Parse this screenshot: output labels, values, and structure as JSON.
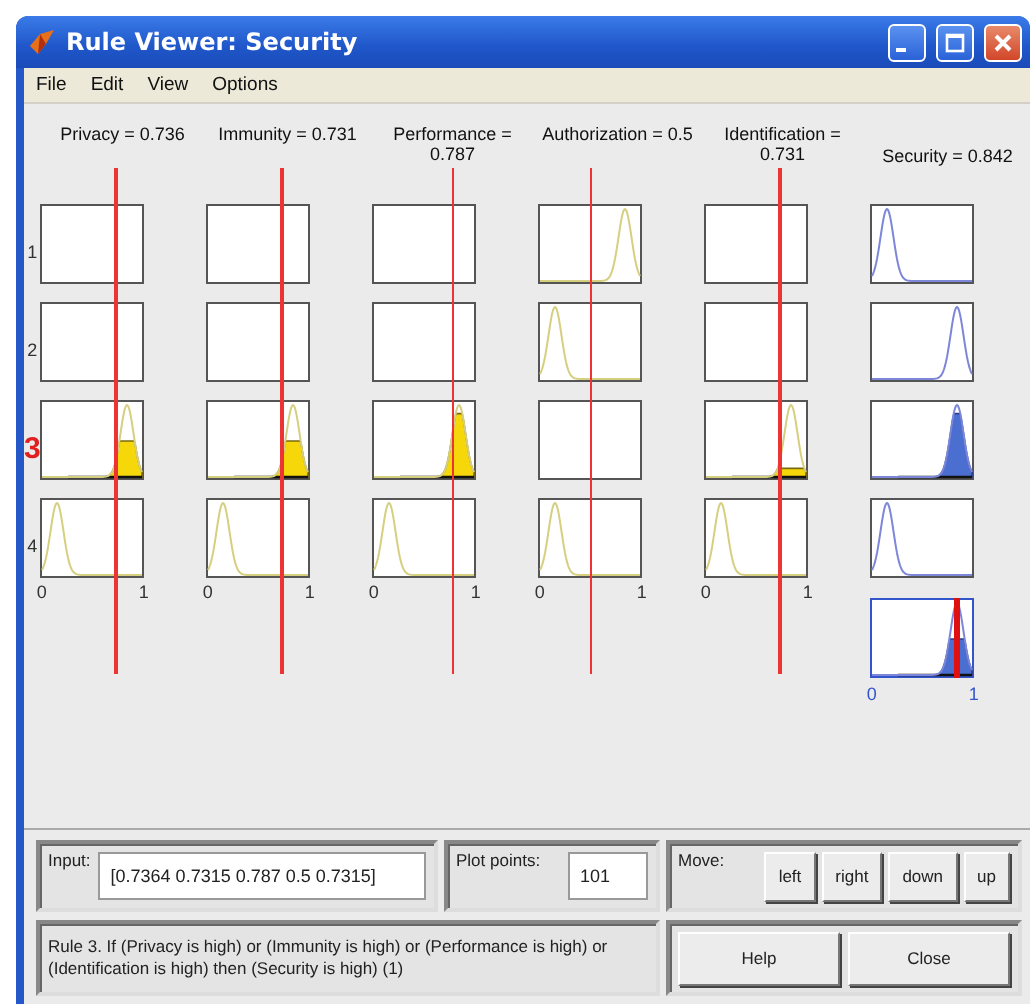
{
  "window": {
    "title": "Rule Viewer: Security"
  },
  "menu": [
    "File",
    "Edit",
    "View",
    "Options"
  ],
  "rules": [
    {
      "label": "1",
      "selected": false
    },
    {
      "label": "2",
      "selected": false
    },
    {
      "label": "3",
      "selected": true
    },
    {
      "label": "4",
      "selected": false
    }
  ],
  "inputs": [
    {
      "label": "Privacy = 0.736",
      "axis": [
        "0",
        "1"
      ],
      "cells": [
        {
          "kind": "blank"
        },
        {
          "kind": "blank"
        },
        {
          "kind": "halffired"
        },
        {
          "kind": "low"
        }
      ]
    },
    {
      "label": "Immunity = 0.731",
      "axis": [
        "0",
        "1"
      ],
      "cells": [
        {
          "kind": "blank"
        },
        {
          "kind": "blank"
        },
        {
          "kind": "halffired"
        },
        {
          "kind": "low"
        }
      ]
    },
    {
      "label": "Performance = 0.787",
      "axis": [
        "0",
        "1"
      ],
      "cells": [
        {
          "kind": "blank"
        },
        {
          "kind": "blank"
        },
        {
          "kind": "fullfired"
        },
        {
          "kind": "low"
        }
      ]
    },
    {
      "label": "Authorization = 0.5",
      "axis": [
        "0",
        "1"
      ],
      "cells": [
        {
          "kind": "high"
        },
        {
          "kind": "low"
        },
        {
          "kind": "blank"
        },
        {
          "kind": "low"
        }
      ]
    },
    {
      "label": "Identification = 0.731",
      "axis": [
        "0",
        "1"
      ],
      "cells": [
        {
          "kind": "blank"
        },
        {
          "kind": "blank"
        },
        {
          "kind": "thinfired"
        },
        {
          "kind": "low"
        }
      ]
    }
  ],
  "output": {
    "label": "Security = 0.842",
    "axis": [
      "0",
      "1"
    ],
    "cells": [
      {
        "kind": "low"
      },
      {
        "kind": "high"
      },
      {
        "kind": "fullfired"
      },
      {
        "kind": "low"
      }
    ],
    "aggregate": {
      "kind": "halffired"
    }
  },
  "input": {
    "label": "Input:",
    "value": "[0.7364 0.7315 0.787 0.5 0.7315]"
  },
  "plot_points": {
    "label": "Plot points:",
    "value": "101"
  },
  "move": {
    "label": "Move:",
    "buttons": [
      "left",
      "right",
      "down",
      "up"
    ]
  },
  "rule_text": "Rule 3. If (Privacy is high) or (Immunity is high) or (Performance is high) or (Identification is high) then (Security is high) (1)",
  "buttons": [
    "Help",
    "Close"
  ]
}
